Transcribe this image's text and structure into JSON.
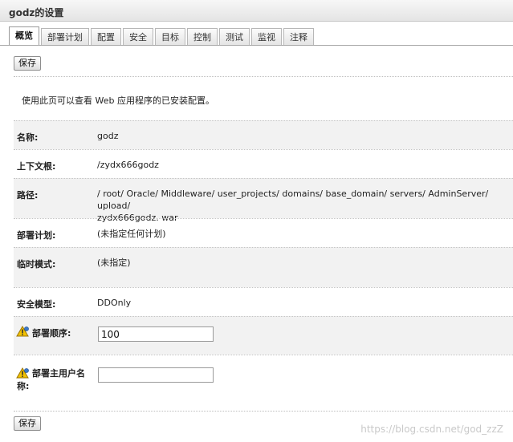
{
  "window": {
    "title": "godz的设置"
  },
  "tabs": [
    {
      "label": "概览",
      "active": true
    },
    {
      "label": "部署计划",
      "active": false
    },
    {
      "label": "配置",
      "active": false
    },
    {
      "label": "安全",
      "active": false
    },
    {
      "label": "目标",
      "active": false
    },
    {
      "label": "控制",
      "active": false
    },
    {
      "label": "测试",
      "active": false
    },
    {
      "label": "监视",
      "active": false
    },
    {
      "label": "注释",
      "active": false
    }
  ],
  "toolbar": {
    "save_label": "保存"
  },
  "description": "使用此页可以查看 Web 应用程序的已安装配置。",
  "fields": {
    "name": {
      "label": "名称:",
      "value": "godz"
    },
    "context_root": {
      "label": "上下文根:",
      "value": "/zydx666godz"
    },
    "path": {
      "label": "路径:",
      "value_line1": "/ root/ Oracle/ Middleware/ user_projects/ domains/ base_domain/ servers/ AdminServer/ upload/",
      "value_line2": "zydx666godz. war"
    },
    "deployment_plan": {
      "label": "部署计划:",
      "value": "(未指定任何计划)"
    },
    "staging_mode": {
      "label": "临时模式:",
      "value": "(未指定)"
    },
    "security_model": {
      "label": "安全模型:",
      "value": "DDOnly"
    },
    "deployment_order": {
      "label": "部署顺序:",
      "value": "100"
    },
    "principal_name": {
      "label_line1": "部署主用户名",
      "label_line2": "称:",
      "value": ""
    }
  },
  "icons": {
    "warning": "warning-icon",
    "warning_color": "#f2c200"
  },
  "watermark": "https://blog.csdn.net/god_zzZ"
}
